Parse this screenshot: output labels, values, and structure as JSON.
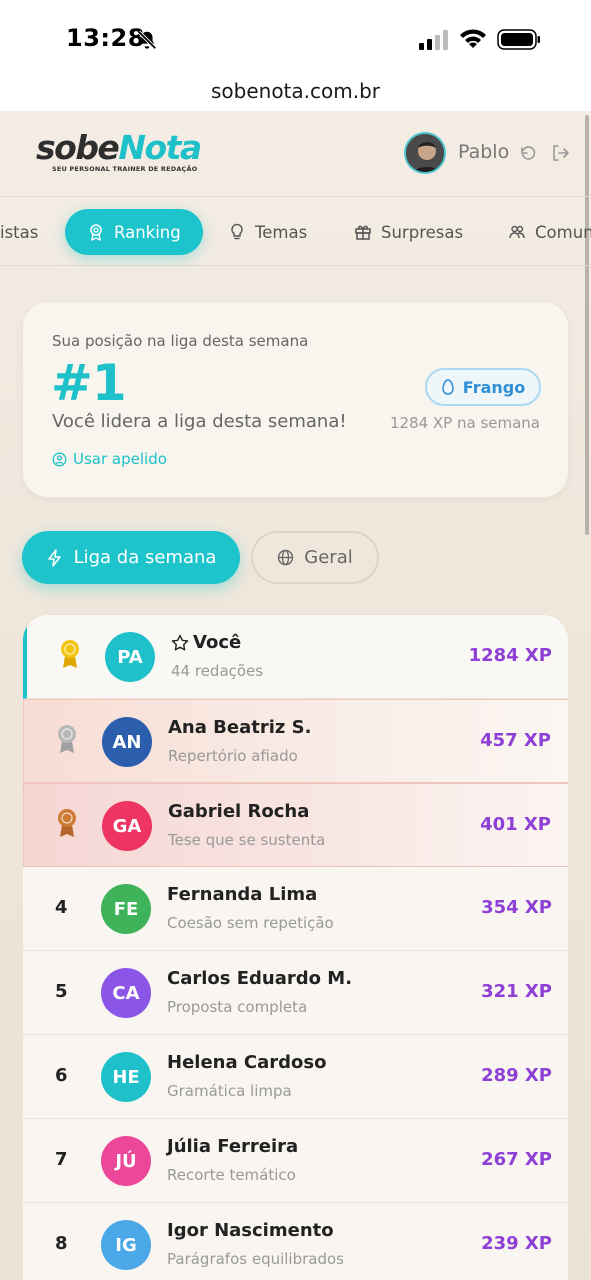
{
  "status_bar": {
    "time": "13:28"
  },
  "browser": {
    "url": "sobenota.com.br"
  },
  "header": {
    "logo_part1": "sobe",
    "logo_part2": "Nota",
    "tagline": "SEU PERSONAL TRAINER DE REDAÇÃO",
    "user_name": "Pablo"
  },
  "nav": {
    "items": [
      {
        "label": "istas",
        "icon": "list-icon"
      },
      {
        "label": "Ranking",
        "icon": "award-icon",
        "active": true
      },
      {
        "label": "Temas",
        "icon": "lightbulb-icon"
      },
      {
        "label": "Surpresas",
        "icon": "gift-icon"
      },
      {
        "label": "Comun",
        "icon": "users-icon"
      }
    ]
  },
  "position_card": {
    "label": "Sua posição na liga desta semana",
    "rank": "#1",
    "message": "Você lidera a liga desta semana!",
    "league": "Frango",
    "weekly_xp": "1284 XP na semana",
    "nickname_link": "Usar apelido"
  },
  "toggle": {
    "week_label": "Liga da semana",
    "general_label": "Geral"
  },
  "ranking": [
    {
      "rank": "1",
      "initials": "PA",
      "name": "Você",
      "subtitle": "44 redações",
      "xp": "1284 XP",
      "avatar_color": "#1ec1c9",
      "medal": "gold",
      "is_me": true
    },
    {
      "rank": "2",
      "initials": "AN",
      "name": "Ana Beatriz S.",
      "subtitle": "Repertório afiado",
      "xp": "457 XP",
      "avatar_color": "#2b5fae",
      "medal": "silver"
    },
    {
      "rank": "3",
      "initials": "GA",
      "name": "Gabriel Rocha",
      "subtitle": "Tese que se sustenta",
      "xp": "401 XP",
      "avatar_color": "#ee3463",
      "medal": "bronze"
    },
    {
      "rank": "4",
      "initials": "FE",
      "name": "Fernanda Lima",
      "subtitle": "Coesão sem repetição",
      "xp": "354 XP",
      "avatar_color": "#3fb35a"
    },
    {
      "rank": "5",
      "initials": "CA",
      "name": "Carlos Eduardo M.",
      "subtitle": "Proposta completa",
      "xp": "321 XP",
      "avatar_color": "#8b55e8"
    },
    {
      "rank": "6",
      "initials": "HE",
      "name": "Helena Cardoso",
      "subtitle": "Gramática limpa",
      "xp": "289 XP",
      "avatar_color": "#1ec1c9"
    },
    {
      "rank": "7",
      "initials": "JÚ",
      "name": "Júlia Ferreira",
      "subtitle": "Recorte temático",
      "xp": "267 XP",
      "avatar_color": "#ec4899"
    },
    {
      "rank": "8",
      "initials": "IG",
      "name": "Igor Nascimento",
      "subtitle": "Parágrafos equilibrados",
      "xp": "239 XP",
      "avatar_color": "#4aa8e8"
    }
  ],
  "colors": {
    "accent": "#1ec1c9",
    "xp": "#8e3fd6",
    "gold": "#f2c40f",
    "silver": "#b8b8b8",
    "bronze": "#cd7a35"
  }
}
